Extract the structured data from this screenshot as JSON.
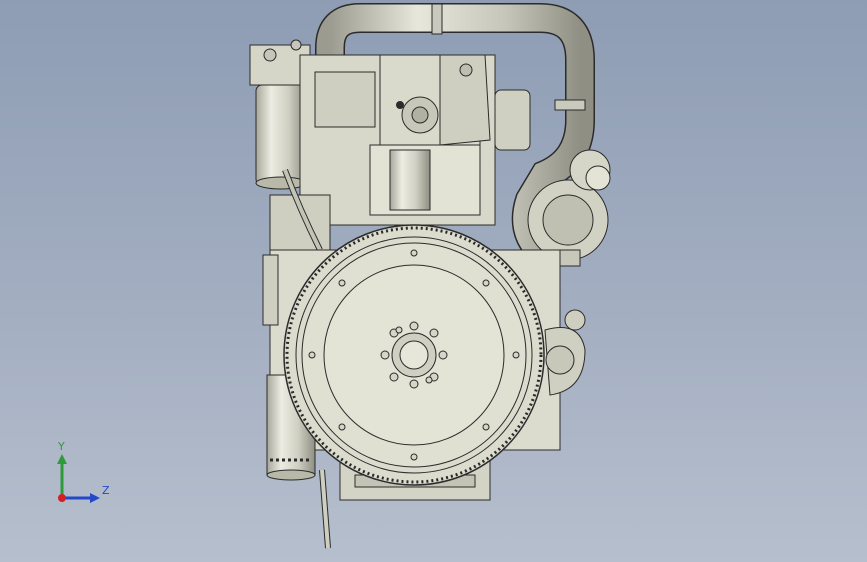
{
  "viewport": {
    "background_top": "#8e9db4",
    "background_bottom": "#b6bfcd",
    "model_fill": "#dcdcce",
    "model_shade": "#b9b9aa",
    "model_dark": "#8a8a7d",
    "outline": "#2b2b2b"
  },
  "triad": {
    "y_label": "Y",
    "z_label": "Z",
    "y_color": "#2f9a3a",
    "z_color": "#2348c8",
    "x_color": "#d42020"
  }
}
